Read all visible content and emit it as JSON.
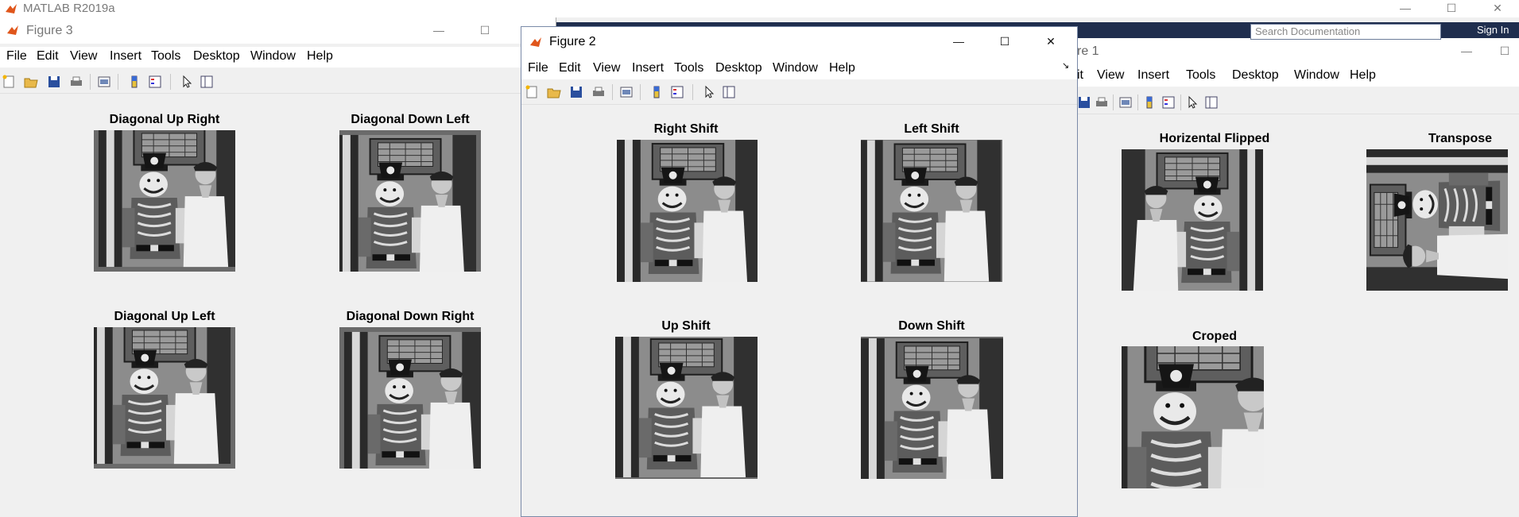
{
  "matlab": {
    "title": "MATLAB R2019a"
  },
  "search": {
    "placeholder": "Search Documentation"
  },
  "signin": "Sign In",
  "menus": [
    "File",
    "Edit",
    "View",
    "Insert",
    "Tools",
    "Desktop",
    "Window",
    "Help"
  ],
  "figure3": {
    "title": "Figure 3",
    "plots": [
      "Diagonal Up Right",
      "Diagonal Down Left",
      "Diagonal Up Left",
      "Diagonal Down Right"
    ]
  },
  "figure2": {
    "title": "Figure 2",
    "plots": [
      "Right Shift",
      "Left Shift",
      "Up Shift",
      "Down Shift"
    ]
  },
  "figure1": {
    "title_partial": "re 1",
    "menus_partial": [
      "it",
      "View",
      "Insert",
      "Tools",
      "Desktop",
      "Window",
      "Help"
    ],
    "plots": [
      "Horizental Flipped",
      "Transpose",
      "Croped"
    ]
  },
  "icons": [
    "new-figure-icon",
    "open-icon",
    "save-icon",
    "print-icon",
    "link-plot-icon",
    "colorbar-icon",
    "legend-icon",
    "pointer-icon",
    "property-editor-icon"
  ],
  "colors": {
    "ribbon": "#1f2e4e",
    "window": "#f0f0f0",
    "titlebar": "#ffffff"
  }
}
